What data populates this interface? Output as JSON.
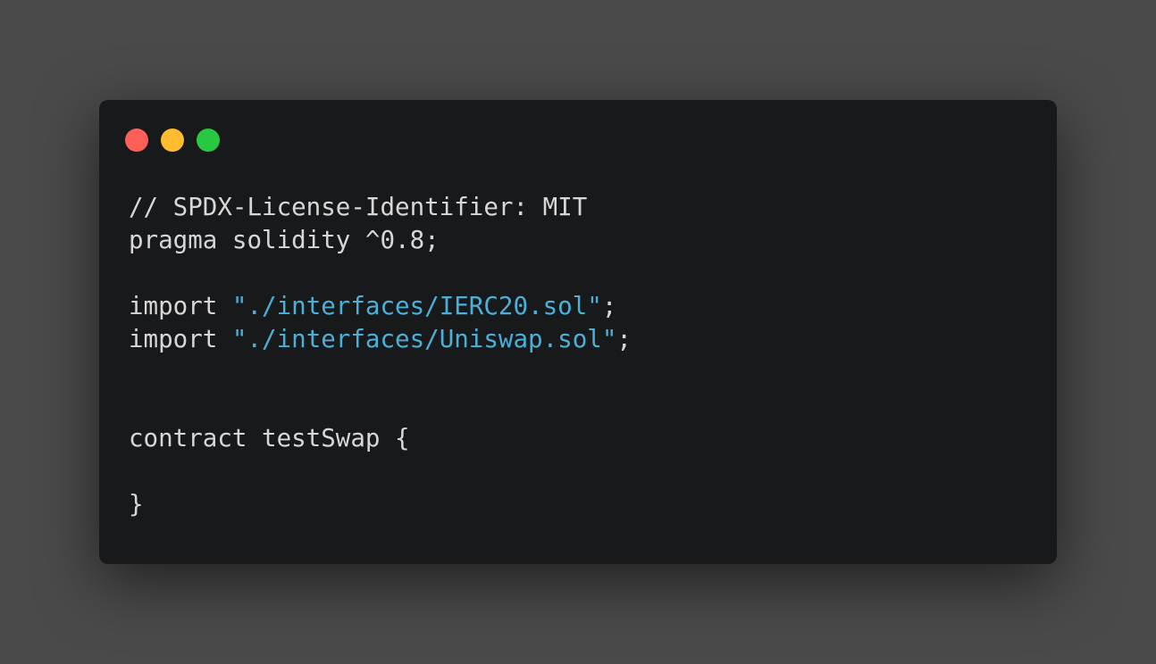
{
  "window": {
    "controls": {
      "close_color": "#fe5f57",
      "minimize_color": "#febc2e",
      "zoom_color": "#28c840"
    }
  },
  "code": {
    "line1": "// SPDX-License-Identifier: MIT",
    "line2": "pragma solidity ^0.8;",
    "line4_keyword": "import ",
    "line4_string": "\"./interfaces/IERC20.sol\"",
    "line4_end": ";",
    "line5_keyword": "import ",
    "line5_string": "\"./interfaces/Uniswap.sol\"",
    "line5_end": ";",
    "line8": "contract testSwap {",
    "line10": "}"
  },
  "colors": {
    "background": "#4a4a4a",
    "editor_background": "#18191b",
    "text": "#d7d7d7",
    "string": "#4bb0d8"
  }
}
